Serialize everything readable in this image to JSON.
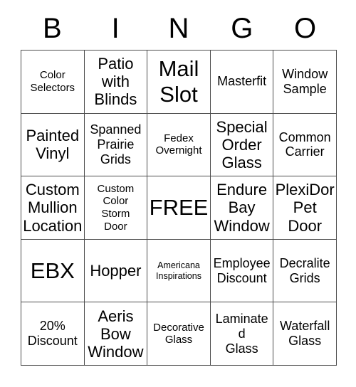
{
  "card": {
    "title_letters": [
      "B",
      "I",
      "N",
      "G",
      "O"
    ],
    "rows": [
      [
        {
          "text": "Color\nSelectors",
          "size": "sm"
        },
        {
          "text": "Patio\nwith\nBlinds",
          "size": "lg"
        },
        {
          "text": "Mail\nSlot",
          "size": "xl"
        },
        {
          "text": "Masterfit",
          "size": "md"
        },
        {
          "text": "Window\nSample",
          "size": "md"
        }
      ],
      [
        {
          "text": "Painted\nVinyl",
          "size": "lg"
        },
        {
          "text": "Spanned\nPrairie\nGrids",
          "size": "md"
        },
        {
          "text": "Fedex\nOvernight",
          "size": "sm"
        },
        {
          "text": "Special\nOrder\nGlass",
          "size": "lg"
        },
        {
          "text": "Common\nCarrier",
          "size": "md"
        }
      ],
      [
        {
          "text": "Custom\nMullion\nLocation",
          "size": "lg"
        },
        {
          "text": "Custom\nColor\nStorm\nDoor",
          "size": "sm"
        },
        {
          "text": "FREE",
          "size": "xl"
        },
        {
          "text": "Endure\nBay\nWindow",
          "size": "lg"
        },
        {
          "text": "PlexiDor\nPet\nDoor",
          "size": "lg"
        }
      ],
      [
        {
          "text": "EBX",
          "size": "xl"
        },
        {
          "text": "Hopper",
          "size": "lg"
        },
        {
          "text": "Americana\nInspirations",
          "size": "xs"
        },
        {
          "text": "Employee\nDiscount",
          "size": "md"
        },
        {
          "text": "Decralite\nGrids",
          "size": "md"
        }
      ],
      [
        {
          "text": "20%\nDiscount",
          "size": "md"
        },
        {
          "text": "Aeris\nBow\nWindow",
          "size": "lg"
        },
        {
          "text": "Decorative\nGlass",
          "size": "sm"
        },
        {
          "text": "Laminated\nGlass",
          "size": "md"
        },
        {
          "text": "Waterfall\nGlass",
          "size": "md"
        }
      ]
    ]
  },
  "colors": {
    "background": "#ffffff",
    "text": "#000000",
    "grid_line": "#4d4d4d"
  }
}
